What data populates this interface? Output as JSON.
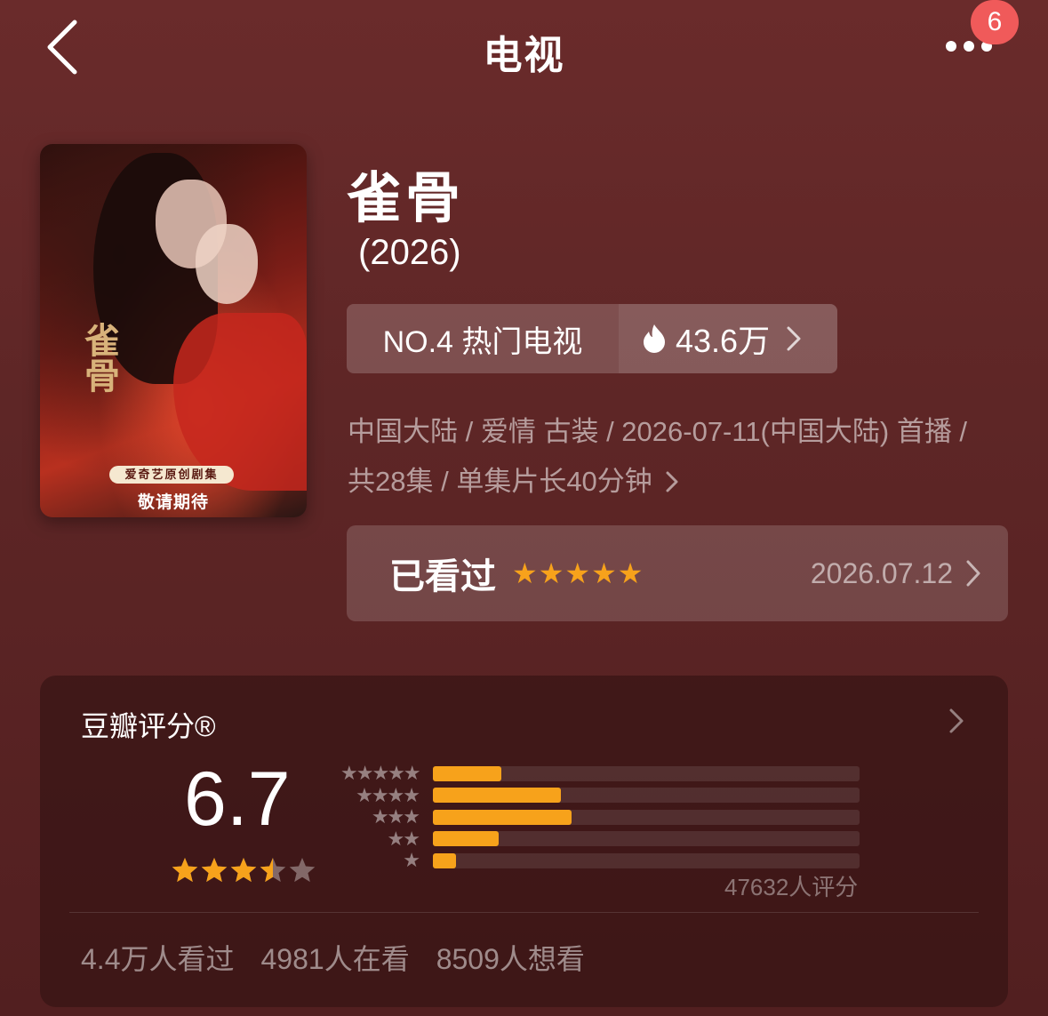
{
  "header": {
    "title": "电视",
    "notification_count": "6"
  },
  "poster": {
    "calligraphy": "雀骨",
    "tag": "爱奇艺原创剧集",
    "tagline": "敬请期待"
  },
  "show": {
    "title": "雀骨",
    "year": "(2026)",
    "rank_label": "NO.4 热门电视",
    "heat": "43.6万",
    "meta": "中国大陆 / 爱情 古装 / 2026-07-11(中国大陆) 首播 / 共28集 / 单集片长40分钟"
  },
  "watched": {
    "label": "已看过",
    "stars": "★★★★★",
    "rating": 5,
    "date": "2026.07.12"
  },
  "douban": {
    "title": "豆瓣评分®",
    "score": "6.7",
    "stars": 3.5,
    "distribution": [
      {
        "stars": "★★★★★",
        "fraction": 0.16
      },
      {
        "stars": "★★★★",
        "fraction": 0.3
      },
      {
        "stars": "★★★",
        "fraction": 0.325
      },
      {
        "stars": "★★",
        "fraction": 0.155
      },
      {
        "stars": "★",
        "fraction": 0.055
      }
    ],
    "rating_count": "47632人评分",
    "stats": {
      "watched": "4.4万人看过",
      "watching": "4981人在看",
      "want": "8509人想看"
    }
  },
  "colors": {
    "accent": "#f7a21b",
    "badge": "#f05a5a",
    "background": "#5e2626"
  }
}
